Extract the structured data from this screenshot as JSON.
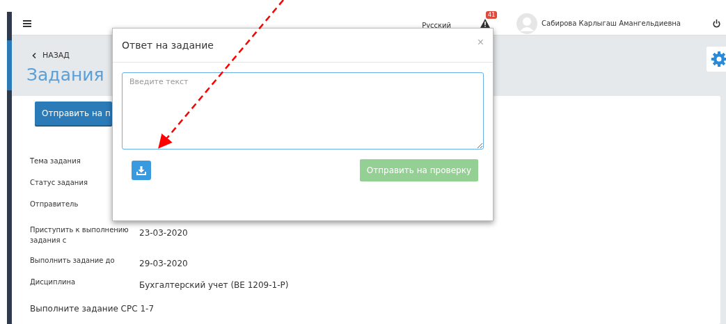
{
  "header": {
    "language": "Русский",
    "notification_count": "41",
    "user_name": "Сабирова Карлыгаш Амангельдиевна"
  },
  "page": {
    "back_link": "НАЗАД",
    "title": "Задания",
    "submit_button": "Отправить на п"
  },
  "details": [
    {
      "label": "Тема задания"
    },
    {
      "label": "Статус задания"
    },
    {
      "label": "Отправитель"
    },
    {
      "label": "Приступить к выполнению задания с",
      "value": "23-03-2020"
    },
    {
      "label": "Выполнить задание до",
      "value": "29-03-2020"
    },
    {
      "label": "Дисциплина",
      "value": "Бухгалтерский учет (BE 1209-1-P)"
    }
  ],
  "task_text": "Выполните задание СРС 1-7",
  "modal": {
    "title": "Ответ на задание",
    "close": "×",
    "textarea": {
      "placeholder": "Введите текст"
    },
    "submit_button": {
      "label": "Отправить на проверку",
      "disabled": true
    }
  }
}
